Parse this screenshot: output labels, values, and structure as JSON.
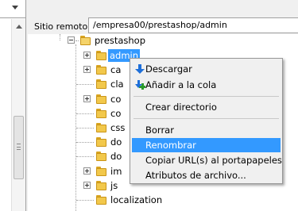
{
  "remote_site": {
    "label": "Sitio remoto:",
    "path": "/empresa00/prestashop/admin"
  },
  "tree": {
    "parent": "prestashop",
    "children": [
      "admin",
      "ca",
      "cla",
      "co",
      "co",
      "css",
      "do",
      "do",
      "im",
      "js",
      "localization"
    ]
  },
  "context_menu": {
    "items": [
      {
        "label": "Descargar",
        "icon": "download-icon"
      },
      {
        "label": "Añadir a la cola",
        "icon": "add-to-queue-icon"
      },
      {
        "label": "Crear directorio"
      },
      {
        "label": "Borrar"
      },
      {
        "label": "Renombrar",
        "highlighted": true
      },
      {
        "label": "Copiar URL(s) al portapapeles"
      },
      {
        "label": "Atributos de archivo..."
      }
    ]
  },
  "colors": {
    "selection": "#3399ff",
    "folder": "#f2c84b"
  }
}
